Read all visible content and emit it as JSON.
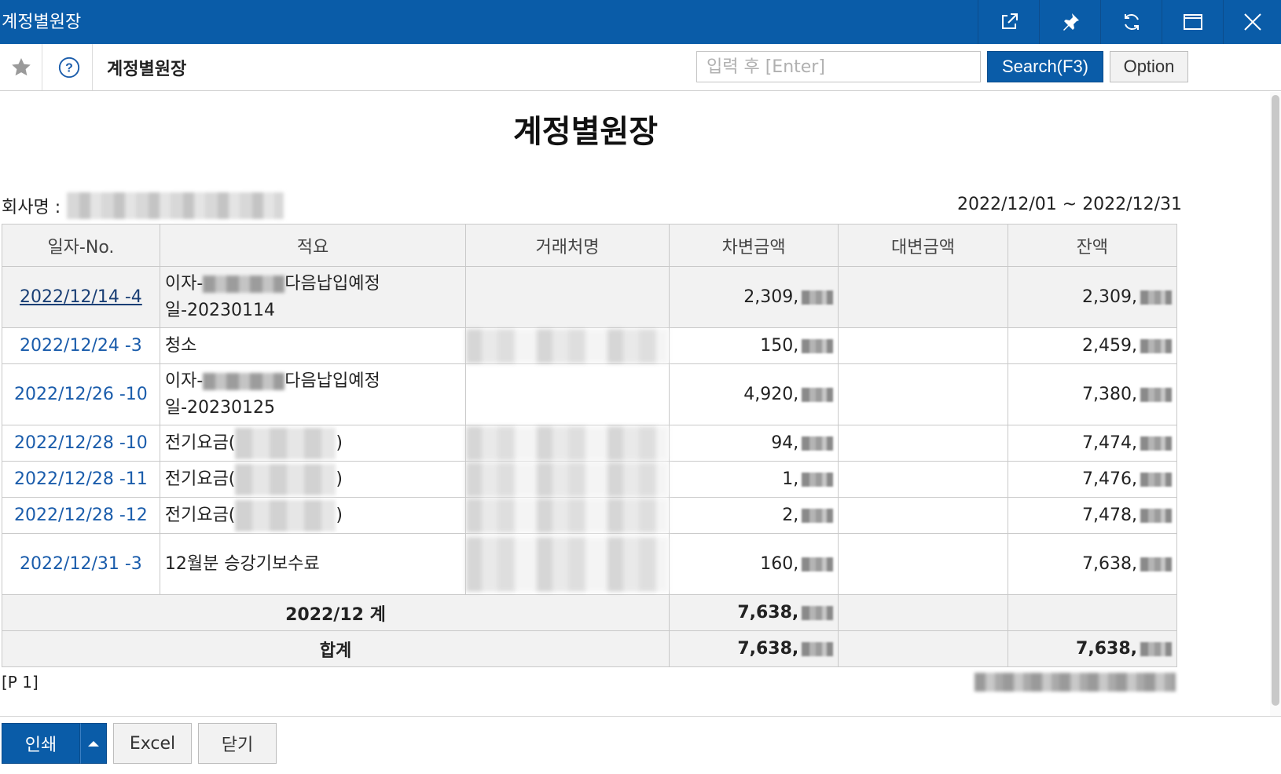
{
  "window": {
    "title": "계정별원장",
    "controls": [
      "open-external-icon",
      "pin-icon",
      "refresh-icon",
      "maximize-icon",
      "close-icon"
    ]
  },
  "toolbar": {
    "page_title": "계정별원장",
    "search_placeholder": "입력 후 [Enter]",
    "search_label": "Search(F3)",
    "option_label": "Option"
  },
  "report": {
    "title": "계정별원장",
    "company_label": "회사명 :",
    "period": "2022/12/01 ~ 2022/12/31",
    "columns": [
      "일자-No.",
      "적요",
      "거래처명",
      "차변금액",
      "대변금액",
      "잔액"
    ],
    "rows": [
      {
        "date": "2022/12/14 -4",
        "desc_pre": "이자-",
        "desc_post": "다음납입예정",
        "desc_line2": "일-20230114",
        "debit": "2,309,",
        "credit": "",
        "balance": "2,309,"
      },
      {
        "date": "2022/12/24 -3",
        "desc_pre": "청소",
        "debit": "150,",
        "credit": "",
        "balance": "2,459,"
      },
      {
        "date": "2022/12/26 -10",
        "desc_pre": "이자-",
        "desc_post": "다음납입예정",
        "desc_line2": "일-20230125",
        "debit": "4,920,",
        "credit": "",
        "balance": "7,380,"
      },
      {
        "date": "2022/12/28 -10",
        "desc_pre": "전기요금(",
        "desc_post": ")",
        "debit": "94,",
        "credit": "",
        "balance": "7,474,"
      },
      {
        "date": "2022/12/28 -11",
        "desc_pre": "전기요금(",
        "desc_post": ")",
        "debit": "1,",
        "credit": "",
        "balance": "7,476,"
      },
      {
        "date": "2022/12/28 -12",
        "desc_pre": "전기요금(",
        "desc_post": ")",
        "debit": "2,",
        "credit": "",
        "balance": "7,478,"
      },
      {
        "date": "2022/12/31 -3",
        "desc_pre": "12월분 승강기보수료",
        "debit": "160,",
        "credit": "",
        "balance": "7,638,"
      }
    ],
    "subtotal": {
      "label": "2022/12 계",
      "debit": "7,638,"
    },
    "total": {
      "label": "합계",
      "debit": "7,638,",
      "balance": "7,638,"
    },
    "page_info": "[P 1]"
  },
  "bottom": {
    "print_label": "인쇄",
    "excel_label": "Excel",
    "close_label": "닫기"
  },
  "colors": {
    "brand": "#0a5ca8",
    "link": "#1a5cab"
  }
}
